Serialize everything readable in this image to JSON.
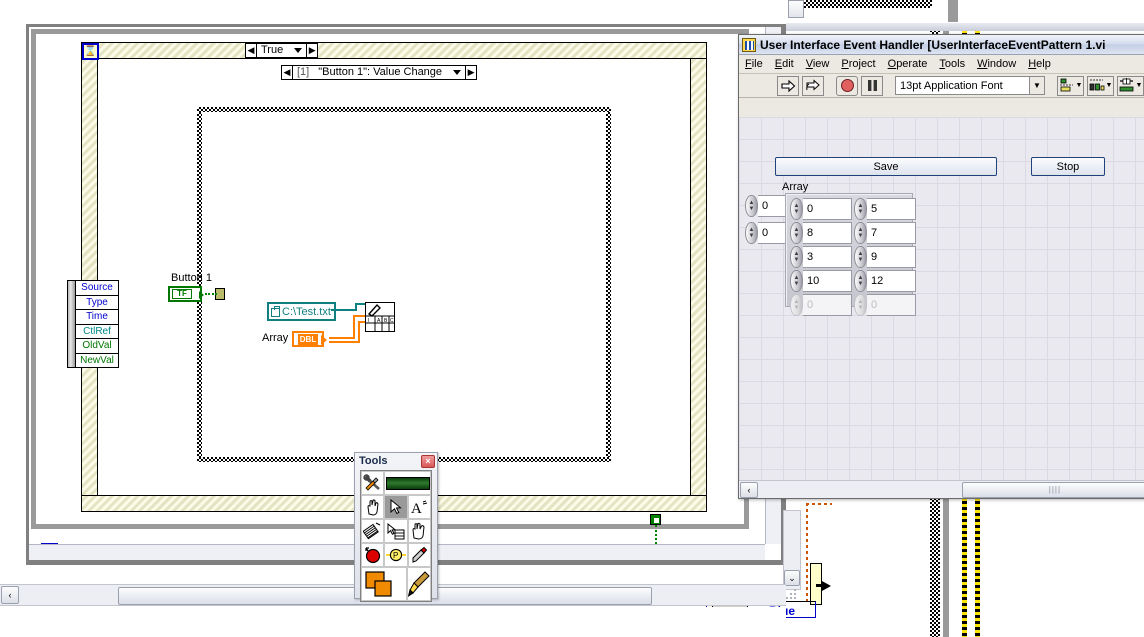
{
  "block_diagram": {
    "window_name": "block-diagram",
    "while_loop": {
      "iteration_terminal": "i",
      "stop_terminal": "stop-sign-icon"
    },
    "event_structure": {
      "timeout_terminal": "hourglass-icon",
      "case_label_index": "[1]",
      "case_label_text": "\"Button 1\": Value Change",
      "event_data_node": [
        {
          "label": "Source",
          "color": "#0000cc"
        },
        {
          "label": "Type",
          "color": "#0000cc"
        },
        {
          "label": "Time",
          "color": "#0000cc"
        },
        {
          "label": "CtlRef",
          "color": "#008888"
        },
        {
          "label": "OldVal",
          "color": "#007700"
        },
        {
          "label": "NewVal",
          "color": "#007700"
        }
      ]
    },
    "case_structure": {
      "case_label_text": "True"
    },
    "nodes": {
      "boolean_terminal_label": "Button 1",
      "boolean_terminal_text": "TF",
      "path_constant_value": "C:\\Test.txt",
      "array_terminal_label": "Array",
      "array_terminal_type": "DBL",
      "vi_icon_name": "write-to-spreadsheet-file-icon"
    },
    "colors": {
      "boolean_green": "#007700",
      "path_teal": "#0f7f7f",
      "array_orange": "#ff7f00",
      "terminal_blue": "#0000cc"
    }
  },
  "tools_palette": {
    "title": "Tools",
    "close_label": "×",
    "buttons": [
      {
        "name": "automatic-tool-selection-icon",
        "label": ""
      },
      {
        "name": "automatic-indicator-icon",
        "label": ""
      },
      {
        "name": "operate-value-hand-icon",
        "label": ""
      },
      {
        "name": "position-size-select-arrow-icon",
        "label": ""
      },
      {
        "name": "edit-text-icon",
        "label": "A"
      },
      {
        "name": "connect-wire-spool-icon",
        "label": ""
      },
      {
        "name": "object-shortcut-menu-icon",
        "label": ""
      },
      {
        "name": "scroll-window-hand-icon",
        "label": ""
      },
      {
        "name": "set-clear-breakpoint-icon",
        "label": ""
      },
      {
        "name": "probe-data-icon",
        "label": "P"
      },
      {
        "name": "get-color-dropper-icon",
        "label": ""
      },
      {
        "name": "set-color-swatch-icon",
        "label": ""
      },
      {
        "name": "set-color-brush-icon",
        "label": ""
      }
    ]
  },
  "front_panel": {
    "title": "User Interface Event Handler [UserInterfaceEventPattern 1.vi",
    "app_icon": "labview-vi-icon",
    "menu": [
      {
        "label": "File",
        "mnemonic": "F"
      },
      {
        "label": "Edit",
        "mnemonic": "E"
      },
      {
        "label": "View",
        "mnemonic": "V"
      },
      {
        "label": "Project",
        "mnemonic": "P"
      },
      {
        "label": "Operate",
        "mnemonic": "O"
      },
      {
        "label": "Tools",
        "mnemonic": "T"
      },
      {
        "label": "Window",
        "mnemonic": "W"
      },
      {
        "label": "Help",
        "mnemonic": "H"
      }
    ],
    "toolbar": {
      "run_icon": "run-arrow-icon",
      "run_continuously_icon": "run-continuously-icon",
      "abort_icon": "abort-execution-icon",
      "pause_icon": "pause-icon",
      "font_selector_value": "13pt Application Font",
      "align_objects_icon": "align-objects-icon",
      "distribute_objects_icon": "distribute-objects-icon",
      "resize_objects_icon": "resize-objects-icon"
    },
    "controls": {
      "save_button_label": "Save",
      "stop_button_label": "Stop",
      "array_caption": "Array",
      "index_values": [
        "0",
        "0"
      ],
      "array_rows": [
        {
          "cells": [
            "0",
            "5"
          ],
          "dimmed": false
        },
        {
          "cells": [
            "8",
            "7"
          ],
          "dimmed": false
        },
        {
          "cells": [
            "3",
            "9"
          ],
          "dimmed": false
        },
        {
          "cells": [
            "10",
            "12"
          ],
          "dimmed": false
        },
        {
          "cells": [
            "0",
            "0"
          ],
          "dimmed": true
        }
      ]
    },
    "scrollbar": {
      "left_arrow": "‹",
      "grip": "||||"
    }
  },
  "background_artifacts": {
    "blue_label": "Blue",
    "scroll_down_arrow": "⌄",
    "scroll_right_arrow": "›"
  }
}
